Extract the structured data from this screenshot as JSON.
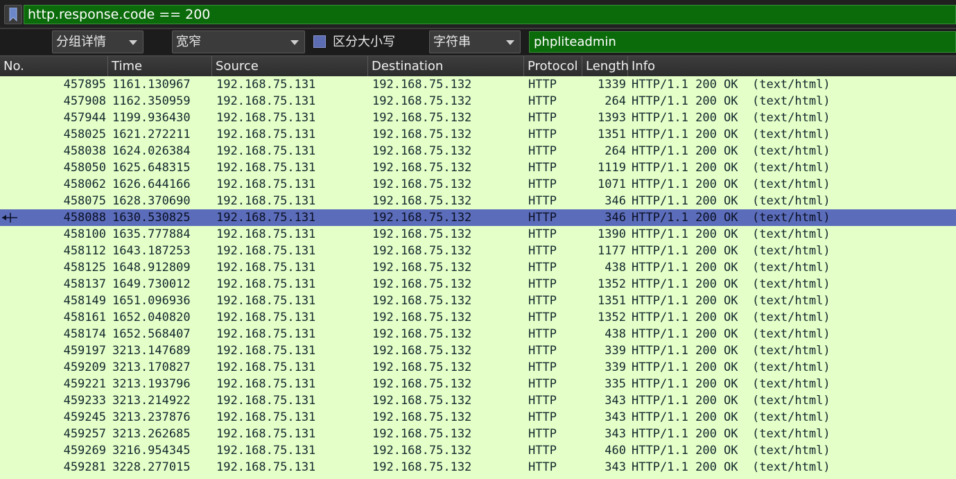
{
  "display_filter": {
    "value": "http.response.code == 200"
  },
  "search_bar": {
    "search_in": "分组详情",
    "char_width": "宽窄",
    "case_sensitive_label": "区分大小写",
    "search_type": "字符串",
    "search_value": "phpliteadmin"
  },
  "columns": [
    "No.",
    "Time",
    "Source",
    "Destination",
    "Protocol",
    "Length",
    "Info"
  ],
  "colors": {
    "row_bg": "#e4ffc7",
    "selected_bg": "#5b6dba",
    "filter_green": "#0b6b0b"
  },
  "selected_row_index": 8,
  "packets": [
    {
      "no": "457895",
      "time": "1161.130967",
      "src": "192.168.75.131",
      "dst": "192.168.75.132",
      "proto": "HTTP",
      "len": "1339",
      "info": "HTTP/1.1 200 OK  (text/html)"
    },
    {
      "no": "457908",
      "time": "1162.350959",
      "src": "192.168.75.131",
      "dst": "192.168.75.132",
      "proto": "HTTP",
      "len": "264",
      "info": "HTTP/1.1 200 OK  (text/html)"
    },
    {
      "no": "457944",
      "time": "1199.936430",
      "src": "192.168.75.131",
      "dst": "192.168.75.132",
      "proto": "HTTP",
      "len": "1393",
      "info": "HTTP/1.1 200 OK  (text/html)"
    },
    {
      "no": "458025",
      "time": "1621.272211",
      "src": "192.168.75.131",
      "dst": "192.168.75.132",
      "proto": "HTTP",
      "len": "1351",
      "info": "HTTP/1.1 200 OK  (text/html)"
    },
    {
      "no": "458038",
      "time": "1624.026384",
      "src": "192.168.75.131",
      "dst": "192.168.75.132",
      "proto": "HTTP",
      "len": "264",
      "info": "HTTP/1.1 200 OK  (text/html)"
    },
    {
      "no": "458050",
      "time": "1625.648315",
      "src": "192.168.75.131",
      "dst": "192.168.75.132",
      "proto": "HTTP",
      "len": "1119",
      "info": "HTTP/1.1 200 OK  (text/html)"
    },
    {
      "no": "458062",
      "time": "1626.644166",
      "src": "192.168.75.131",
      "dst": "192.168.75.132",
      "proto": "HTTP",
      "len": "1071",
      "info": "HTTP/1.1 200 OK  (text/html)"
    },
    {
      "no": "458075",
      "time": "1628.370690",
      "src": "192.168.75.131",
      "dst": "192.168.75.132",
      "proto": "HTTP",
      "len": "346",
      "info": "HTTP/1.1 200 OK  (text/html)"
    },
    {
      "no": "458088",
      "time": "1630.530825",
      "src": "192.168.75.131",
      "dst": "192.168.75.132",
      "proto": "HTTP",
      "len": "346",
      "info": "HTTP/1.1 200 OK  (text/html)"
    },
    {
      "no": "458100",
      "time": "1635.777884",
      "src": "192.168.75.131",
      "dst": "192.168.75.132",
      "proto": "HTTP",
      "len": "1390",
      "info": "HTTP/1.1 200 OK  (text/html)"
    },
    {
      "no": "458112",
      "time": "1643.187253",
      "src": "192.168.75.131",
      "dst": "192.168.75.132",
      "proto": "HTTP",
      "len": "1177",
      "info": "HTTP/1.1 200 OK  (text/html)"
    },
    {
      "no": "458125",
      "time": "1648.912809",
      "src": "192.168.75.131",
      "dst": "192.168.75.132",
      "proto": "HTTP",
      "len": "438",
      "info": "HTTP/1.1 200 OK  (text/html)"
    },
    {
      "no": "458137",
      "time": "1649.730012",
      "src": "192.168.75.131",
      "dst": "192.168.75.132",
      "proto": "HTTP",
      "len": "1352",
      "info": "HTTP/1.1 200 OK  (text/html)"
    },
    {
      "no": "458149",
      "time": "1651.096936",
      "src": "192.168.75.131",
      "dst": "192.168.75.132",
      "proto": "HTTP",
      "len": "1351",
      "info": "HTTP/1.1 200 OK  (text/html)"
    },
    {
      "no": "458161",
      "time": "1652.040820",
      "src": "192.168.75.131",
      "dst": "192.168.75.132",
      "proto": "HTTP",
      "len": "1352",
      "info": "HTTP/1.1 200 OK  (text/html)"
    },
    {
      "no": "458174",
      "time": "1652.568407",
      "src": "192.168.75.131",
      "dst": "192.168.75.132",
      "proto": "HTTP",
      "len": "438",
      "info": "HTTP/1.1 200 OK  (text/html)"
    },
    {
      "no": "459197",
      "time": "3213.147689",
      "src": "192.168.75.131",
      "dst": "192.168.75.132",
      "proto": "HTTP",
      "len": "339",
      "info": "HTTP/1.1 200 OK  (text/html)"
    },
    {
      "no": "459209",
      "time": "3213.170827",
      "src": "192.168.75.131",
      "dst": "192.168.75.132",
      "proto": "HTTP",
      "len": "339",
      "info": "HTTP/1.1 200 OK  (text/html)"
    },
    {
      "no": "459221",
      "time": "3213.193796",
      "src": "192.168.75.131",
      "dst": "192.168.75.132",
      "proto": "HTTP",
      "len": "335",
      "info": "HTTP/1.1 200 OK  (text/html)"
    },
    {
      "no": "459233",
      "time": "3213.214922",
      "src": "192.168.75.131",
      "dst": "192.168.75.132",
      "proto": "HTTP",
      "len": "343",
      "info": "HTTP/1.1 200 OK  (text/html)"
    },
    {
      "no": "459245",
      "time": "3213.237876",
      "src": "192.168.75.131",
      "dst": "192.168.75.132",
      "proto": "HTTP",
      "len": "343",
      "info": "HTTP/1.1 200 OK  (text/html)"
    },
    {
      "no": "459257",
      "time": "3213.262685",
      "src": "192.168.75.131",
      "dst": "192.168.75.132",
      "proto": "HTTP",
      "len": "343",
      "info": "HTTP/1.1 200 OK  (text/html)"
    },
    {
      "no": "459269",
      "time": "3216.954345",
      "src": "192.168.75.131",
      "dst": "192.168.75.132",
      "proto": "HTTP",
      "len": "460",
      "info": "HTTP/1.1 200 OK  (text/html)"
    },
    {
      "no": "459281",
      "time": "3228.277015",
      "src": "192.168.75.131",
      "dst": "192.168.75.132",
      "proto": "HTTP",
      "len": "343",
      "info": "HTTP/1.1 200 OK  (text/html)"
    }
  ]
}
